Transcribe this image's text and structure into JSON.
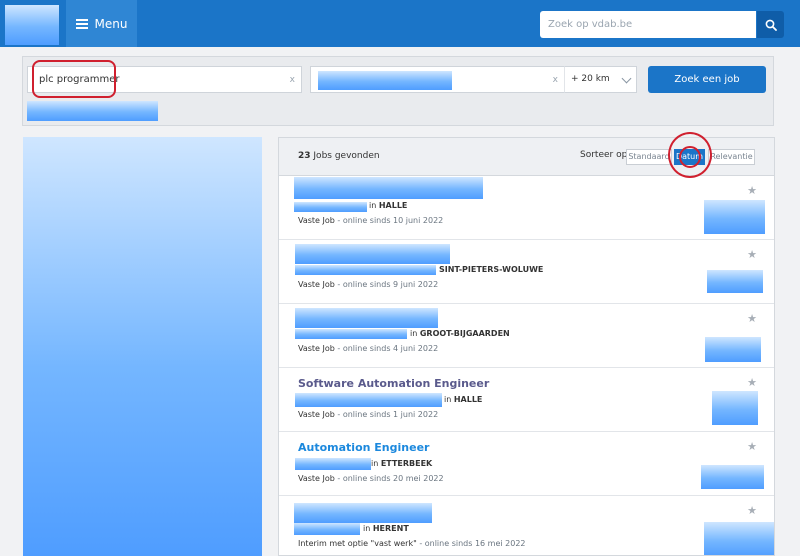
{
  "header": {
    "menu_label": "Menu",
    "search_placeholder": "Zoek op vdab.be"
  },
  "filters": {
    "keyword_value": "plc programmer",
    "clear_symbol": "x",
    "distance_value": "+ 20 km",
    "search_button": "Zoek een job"
  },
  "results": {
    "count": "23",
    "count_label": "Jobs gevonden",
    "sort_label": "Sorteer op",
    "sort_options": [
      "Standaard",
      "Datum",
      "Relevantie"
    ],
    "sort_selected": "Datum",
    "jobs": [
      {
        "title": "",
        "location_prefix": "in",
        "location": "HALLE",
        "type": "Vaste Job",
        "meta": "- online sinds 10 juni 2022"
      },
      {
        "title": "",
        "location_prefix": "",
        "location": "SINT-PIETERS-WOLUWE",
        "type": "Vaste Job",
        "meta": "- online sinds 9 juni 2022"
      },
      {
        "title": "",
        "location_prefix": "in",
        "location": "GROOT-BIJGAARDEN",
        "type": "Vaste Job",
        "meta": "- online sinds 4 juni 2022"
      },
      {
        "title": "Software Automation Engineer",
        "location_prefix": "in",
        "location": "HALLE",
        "type": "Vaste Job",
        "meta": "- online sinds 1 juni 2022"
      },
      {
        "title": "Automation Engineer",
        "location_prefix": "in",
        "location": "ETTERBEEK",
        "type": "Vaste Job",
        "meta": "- online sinds 20 mei 2022"
      },
      {
        "title": "",
        "location_prefix": "in",
        "location": "HERENT",
        "type": "Interim met optie \"vast werk\"",
        "meta": "- online sinds 16 mei 2022"
      }
    ]
  },
  "colors": {
    "primary": "#1b75c8",
    "title_visited": "#5a5a8c",
    "title_link": "#1b88dd",
    "annotation_red": "#d0202f"
  }
}
